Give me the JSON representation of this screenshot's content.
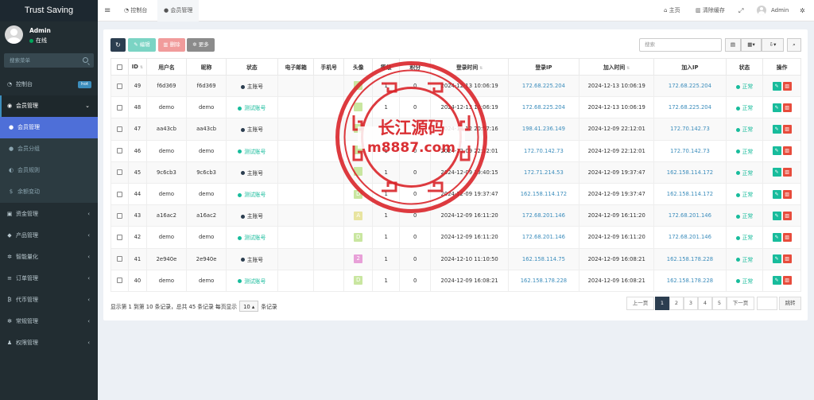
{
  "app": {
    "title": "Trust Saving"
  },
  "user": {
    "name": "Admin",
    "status": "在线"
  },
  "sidebar": {
    "search_placeholder": "搜索菜单",
    "items": [
      {
        "label": "控制台",
        "icon": "dashboard-icon",
        "badge": "hot"
      },
      {
        "label": "会员管理",
        "icon": "user-circle-icon"
      },
      {
        "label": "会员管理",
        "icon": "user-icon"
      },
      {
        "label": "会员分组",
        "icon": "users-icon"
      },
      {
        "label": "会员规则",
        "icon": "rule-icon"
      },
      {
        "label": "余额变动",
        "icon": "dollar-icon"
      },
      {
        "label": "资金管理",
        "icon": "wallet-icon"
      },
      {
        "label": "产品管理",
        "icon": "product-icon"
      },
      {
        "label": "智能量化",
        "icon": "gear-icon"
      },
      {
        "label": "订单管理",
        "icon": "list-icon"
      },
      {
        "label": "代币管理",
        "icon": "bitcoin-icon"
      },
      {
        "label": "常规管理",
        "icon": "cogs-icon"
      },
      {
        "label": "权限管理",
        "icon": "group-icon"
      }
    ]
  },
  "navbar": {
    "tabs": [
      {
        "label": "控制台"
      },
      {
        "label": "会员管理"
      }
    ],
    "home": "主页",
    "clear_cache": "清除缓存",
    "admin": "Admin"
  },
  "toolbar": {
    "edit": "编辑",
    "delete": "删除",
    "more": "更多",
    "search_placeholder": "搜索"
  },
  "table": {
    "headers": [
      "ID",
      "用户名",
      "昵称",
      "状态",
      "电子邮箱",
      "手机号",
      "头像",
      "等级",
      "积分",
      "登录时间",
      "登录IP",
      "加入时间",
      "加入IP",
      "状态",
      "操作"
    ],
    "rows": [
      {
        "id": "49",
        "username": "f6d369",
        "nickname": "f6d369",
        "type": "主账号",
        "type_kind": "main",
        "email": "",
        "phone": "",
        "avatar": "",
        "avatar_color": "#c9e6a0",
        "level": "1",
        "score": "0",
        "login_time": "2024-12-13 10:06:19",
        "login_ip": "172.68.225.204",
        "join_time": "2024-12-13 10:06:19",
        "join_ip": "172.68.225.204",
        "status": "正常"
      },
      {
        "id": "48",
        "username": "demo",
        "nickname": "demo",
        "type": "测试账号",
        "type_kind": "test",
        "email": "",
        "phone": "",
        "avatar": "",
        "avatar_color": "#c9e6a0",
        "level": "1",
        "score": "0",
        "login_time": "2024-12-13 10:06:19",
        "login_ip": "172.68.225.204",
        "join_time": "2024-12-13 10:06:19",
        "join_ip": "172.68.225.204",
        "status": "正常"
      },
      {
        "id": "47",
        "username": "aa43cb",
        "nickname": "aa43cb",
        "type": "主账号",
        "type_kind": "main",
        "email": "",
        "phone": "",
        "avatar": "",
        "avatar_color": "#c9e6a0",
        "level": "1",
        "score": "0",
        "login_time": "2024-12-12 20:57:16",
        "login_ip": "198.41.236.149",
        "join_time": "2024-12-09 22:12:01",
        "join_ip": "172.70.142.73",
        "status": "正常"
      },
      {
        "id": "46",
        "username": "demo",
        "nickname": "demo",
        "type": "测试账号",
        "type_kind": "test",
        "email": "",
        "phone": "",
        "avatar": "",
        "avatar_color": "#c9e6a0",
        "level": "1",
        "score": "0",
        "login_time": "2024-12-09 22:12:01",
        "login_ip": "172.70.142.73",
        "join_time": "2024-12-09 22:12:01",
        "join_ip": "172.70.142.73",
        "status": "正常"
      },
      {
        "id": "45",
        "username": "9c6cb3",
        "nickname": "9c6cb3",
        "type": "主账号",
        "type_kind": "main",
        "email": "",
        "phone": "",
        "avatar": "",
        "avatar_color": "#c9e6a0",
        "level": "1",
        "score": "0",
        "login_time": "2024-12-09 19:40:15",
        "login_ip": "172.71.214.53",
        "join_time": "2024-12-09 19:37:47",
        "join_ip": "162.158.114.172",
        "status": "正常"
      },
      {
        "id": "44",
        "username": "demo",
        "nickname": "demo",
        "type": "测试账号",
        "type_kind": "test",
        "email": "",
        "phone": "",
        "avatar": "D",
        "avatar_color": "#c9e6a0",
        "level": "1",
        "score": "0",
        "login_time": "2024-12-09 19:37:47",
        "login_ip": "162.158.114.172",
        "join_time": "2024-12-09 19:37:47",
        "join_ip": "162.158.114.172",
        "status": "正常"
      },
      {
        "id": "43",
        "username": "a16ac2",
        "nickname": "a16ac2",
        "type": "主账号",
        "type_kind": "main",
        "email": "",
        "phone": "",
        "avatar": "A",
        "avatar_color": "#e8e4a0",
        "level": "1",
        "score": "0",
        "login_time": "2024-12-09 16:11:20",
        "login_ip": "172.68.201.146",
        "join_time": "2024-12-09 16:11:20",
        "join_ip": "172.68.201.146",
        "status": "正常"
      },
      {
        "id": "42",
        "username": "demo",
        "nickname": "demo",
        "type": "测试账号",
        "type_kind": "test",
        "email": "",
        "phone": "",
        "avatar": "D",
        "avatar_color": "#c9e6a0",
        "level": "1",
        "score": "0",
        "login_time": "2024-12-09 16:11:20",
        "login_ip": "172.68.201.146",
        "join_time": "2024-12-09 16:11:20",
        "join_ip": "172.68.201.146",
        "status": "正常"
      },
      {
        "id": "41",
        "username": "2e940e",
        "nickname": "2e940e",
        "type": "主账号",
        "type_kind": "main",
        "email": "",
        "phone": "",
        "avatar": "2",
        "avatar_color": "#e8a0d8",
        "level": "1",
        "score": "0",
        "login_time": "2024-12-10 11:10:50",
        "login_ip": "162.158.114.75",
        "join_time": "2024-12-09 16:08:21",
        "join_ip": "162.158.178.228",
        "status": "正常"
      },
      {
        "id": "40",
        "username": "demo",
        "nickname": "demo",
        "type": "测试账号",
        "type_kind": "test",
        "email": "",
        "phone": "",
        "avatar": "D",
        "avatar_color": "#c9e6a0",
        "level": "1",
        "score": "0",
        "login_time": "2024-12-09 16:08:21",
        "login_ip": "162.158.178.228",
        "join_time": "2024-12-09 16:08:21",
        "join_ip": "162.158.178.228",
        "status": "正常"
      }
    ]
  },
  "pagination": {
    "info_prefix": "显示第 1 到第 10 条记录，总共 45 条记录 每页显示",
    "page_size": "10",
    "info_suffix": "条记录",
    "prev": "上一页",
    "pages": [
      "1",
      "2",
      "3",
      "4",
      "5"
    ],
    "next": "下一页",
    "jump": "跳转"
  },
  "watermark": {
    "text1": "长江源码",
    "text2": "m8887.com"
  }
}
